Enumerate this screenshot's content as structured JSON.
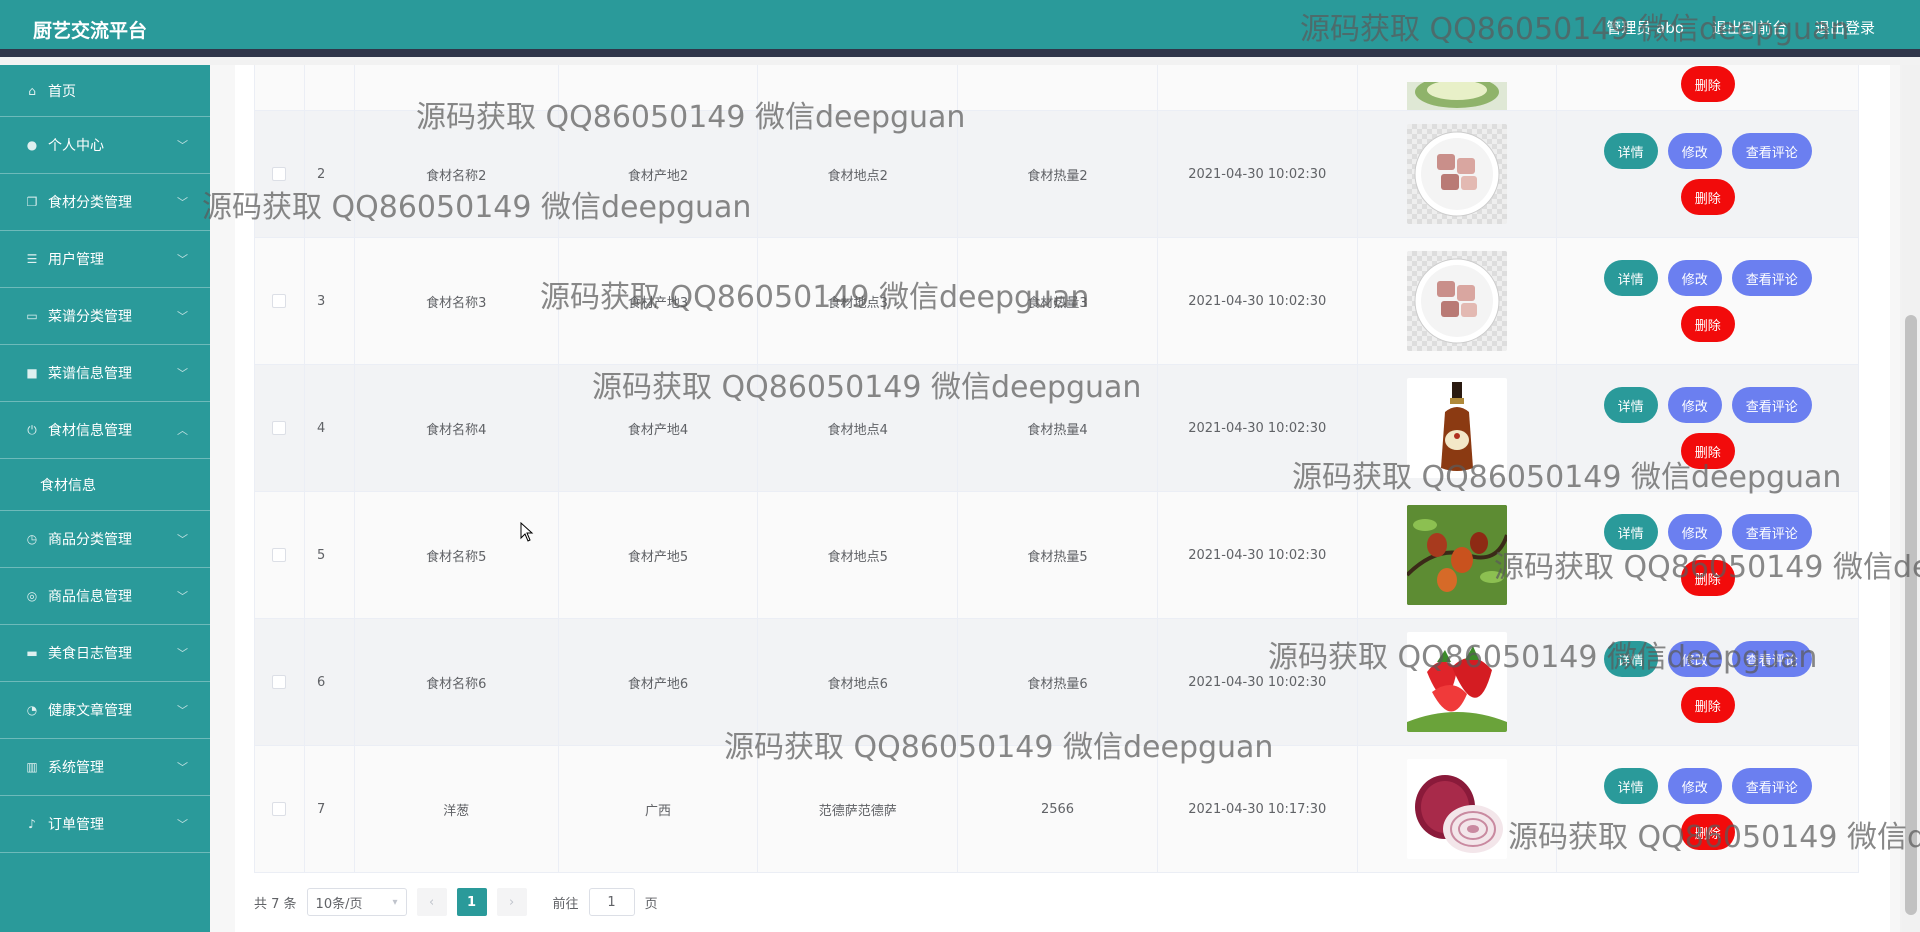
{
  "header": {
    "brand": "厨艺交流平台",
    "admin_label": "管理员 abo",
    "backend_label": "退出到前台",
    "logout_label": "退出登录"
  },
  "sidebar": {
    "items": [
      {
        "label": "首页",
        "icon": "home-icon"
      },
      {
        "label": "个人中心",
        "icon": "user-icon"
      },
      {
        "label": "食材分类管理",
        "icon": "copy-icon"
      },
      {
        "label": "用户管理",
        "icon": "list-icon"
      },
      {
        "label": "菜谱分类管理",
        "icon": "chat-icon"
      },
      {
        "label": "菜谱信息管理",
        "icon": "monitor-icon"
      },
      {
        "label": "食材信息管理",
        "icon": "power-icon"
      },
      {
        "label": "商品分类管理",
        "icon": "clock-icon"
      },
      {
        "label": "商品信息管理",
        "icon": "compass-icon"
      },
      {
        "label": "美食日志管理",
        "icon": "shop-icon"
      },
      {
        "label": "健康文章管理",
        "icon": "gauge-icon"
      },
      {
        "label": "系统管理",
        "icon": "chart-icon"
      },
      {
        "label": "订单管理",
        "icon": "mic-icon"
      }
    ],
    "submenu_label": "食材信息"
  },
  "table": {
    "rows": [
      {
        "idx": "2",
        "name": "食材名称2",
        "origin": "食材产地2",
        "location": "食材地点2",
        "heat": "食材热量2",
        "time": "2021-04-30 10:02:30",
        "image": "meat-plate"
      },
      {
        "idx": "3",
        "name": "食材名称3",
        "origin": "食材产地3",
        "location": "食材地点3",
        "heat": "食材热量3",
        "time": "2021-04-30 10:02:30",
        "image": "meat-plate"
      },
      {
        "idx": "4",
        "name": "食材名称4",
        "origin": "食材产地4",
        "location": "食材地点4",
        "heat": "食材热量4",
        "time": "2021-04-30 10:02:30",
        "image": "cognac-bottle"
      },
      {
        "idx": "5",
        "name": "食材名称5",
        "origin": "食材产地5",
        "location": "食材地点5",
        "heat": "食材热量5",
        "time": "2021-04-30 10:02:30",
        "image": "jujube-branch"
      },
      {
        "idx": "6",
        "name": "食材名称6",
        "origin": "食材产地6",
        "location": "食材地点6",
        "heat": "食材热量6",
        "time": "2021-04-30 10:02:30",
        "image": "strawberry"
      },
      {
        "idx": "7",
        "name": "洋葱",
        "origin": "广西",
        "location": "范德萨范德萨",
        "heat": "2566",
        "time": "2021-04-30 10:17:30",
        "image": "red-onion"
      }
    ],
    "actions": {
      "detail": "详情",
      "edit": "修改",
      "comments": "查看评论",
      "delete": "删除"
    }
  },
  "pagination": {
    "total": "共 7 条",
    "page_size": "10条/页",
    "current_page": "1",
    "goto_prefix": "前往",
    "goto_value": "1",
    "goto_suffix": "页"
  },
  "watermark": "源码获取 QQ86050149 微信deepguan",
  "colors": {
    "primary": "#2a9a9a",
    "secondary": "#6b7ff0",
    "danger": "#f20b0b",
    "header_border": "#30364a"
  }
}
